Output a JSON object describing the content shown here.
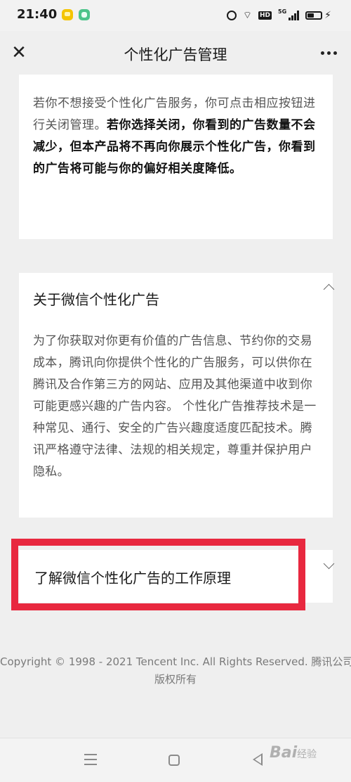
{
  "status_bar": {
    "time": "21:40",
    "network": "5G",
    "hd_badge": "HD",
    "wifi_icon": "wifi-icon",
    "charging_icon": "lightning-icon"
  },
  "nav": {
    "close_icon": "✕",
    "title": "个性化广告管理",
    "more_icon": "more-dots-icon"
  },
  "card1": {
    "text_normal": "若你不想接受个性化广告服务，你可点击相应按钮进行关闭管理。",
    "text_bold": "若你选择关闭，你看到的广告数量不会减少，但本产品将不再向你展示个性化广告，你看到的广告将可能与你的偏好相关度降低。"
  },
  "card2": {
    "title": "关于微信个性化广告",
    "expanded": true,
    "body": "为了你获取对你更有价值的广告信息、节约你的交易成本，腾讯向你提供个性化的广告服务，可以供你在腾讯及合作第三方的网站、应用及其他渠道中收到你可能更感兴趣的广告内容。 个性化广告推荐技术是一种常见、通行、安全的广告兴趣度适度匹配技术。腾讯严格遵守法律、法规的相关规定，尊重并保护用户隐私。"
  },
  "card3": {
    "title": "了解微信个性化广告的工作原理",
    "expanded": false
  },
  "highlight_color": "#e8283f",
  "footer": {
    "line1": "Copyright © 1998 - 2021 Tencent Inc. All Rights Reserved. 腾讯公司",
    "line2": "版权所有"
  },
  "watermark": {
    "brand": "Bai",
    "suffix": "经验"
  }
}
